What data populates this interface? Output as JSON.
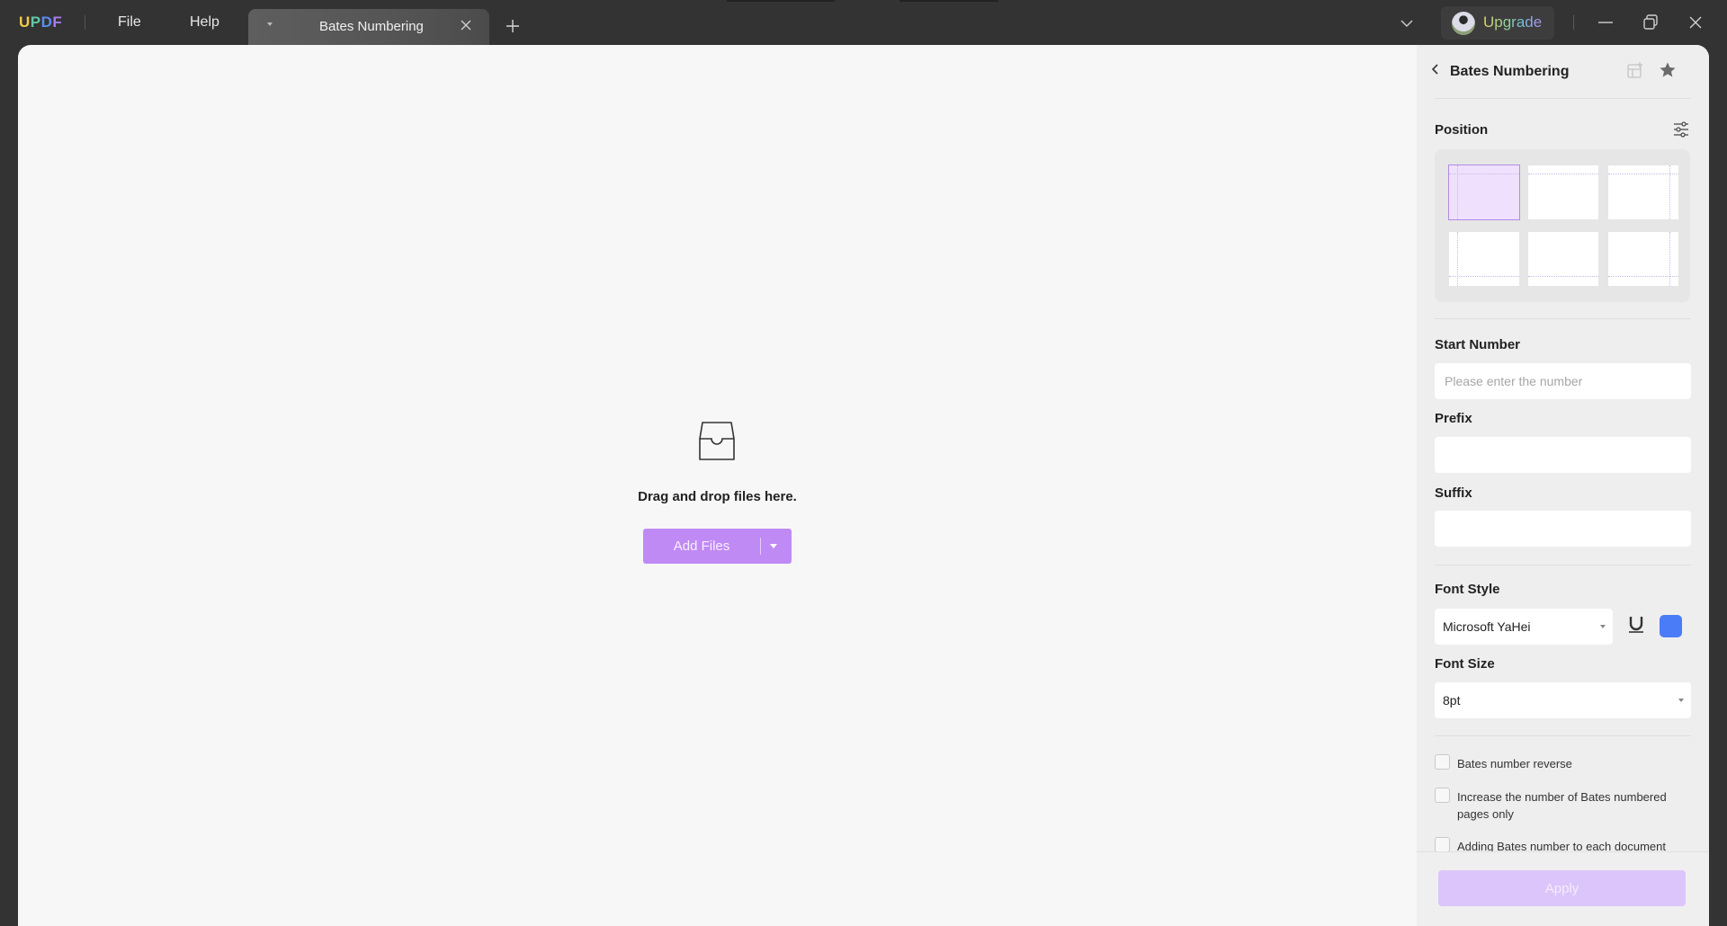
{
  "app": {
    "logo": [
      "U",
      "P",
      "D",
      "F"
    ],
    "menu": {
      "file": "File",
      "help": "Help"
    },
    "tab": {
      "label": "Bates Numbering"
    },
    "upgrade_label": "Upgrade"
  },
  "dropzone": {
    "text": "Drag and drop files here.",
    "add_files_label": "Add Files"
  },
  "panel": {
    "title": "Bates Numbering",
    "position_label": "Position",
    "positions": [
      {
        "name": "top-left",
        "selected": true
      },
      {
        "name": "top-center",
        "selected": false
      },
      {
        "name": "top-right",
        "selected": false
      },
      {
        "name": "bottom-left",
        "selected": false
      },
      {
        "name": "bottom-center",
        "selected": false
      },
      {
        "name": "bottom-right",
        "selected": false
      }
    ],
    "start_number": {
      "label": "Start Number",
      "value": "",
      "placeholder": "Please enter the number"
    },
    "prefix": {
      "label": "Prefix",
      "value": ""
    },
    "suffix": {
      "label": "Suffix",
      "value": ""
    },
    "font_style": {
      "label": "Font Style",
      "value": "Microsoft YaHei",
      "color": "#4a7cf7",
      "underline": false
    },
    "font_size": {
      "label": "Font Size",
      "value": "8pt"
    },
    "options": [
      {
        "label": "Bates number reverse",
        "checked": false
      },
      {
        "label": "Increase the number of Bates numbered pages only",
        "checked": false
      },
      {
        "label": "Adding Bates number to each document",
        "checked": false
      }
    ],
    "apply_label": "Apply"
  },
  "colors": {
    "accent": "#c08af5",
    "apply_disabled": "#dcc5fa",
    "titlebar": "#333333"
  }
}
